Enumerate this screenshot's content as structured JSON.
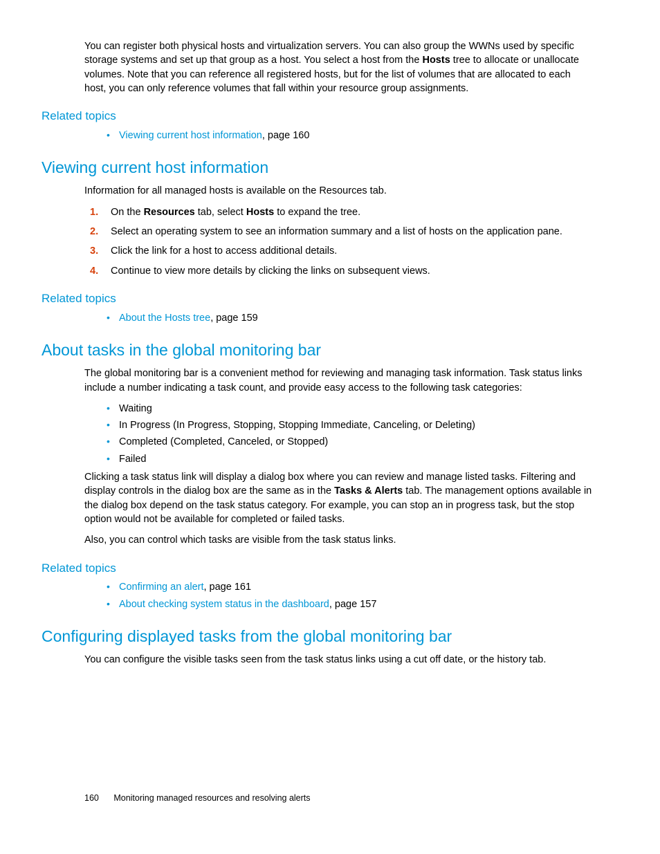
{
  "intro": {
    "p1_a": "You can register both physical hosts and virtualization servers. You can also group the WWNs used by specific storage systems and set up that group as a host. You select a host from the ",
    "p1_b": "Hosts",
    "p1_c": " tree to allocate or unallocate volumes. Note that you can reference all registered hosts, but for the list of volumes that are allocated to each host, you can only reference volumes that fall within your resource group assignments."
  },
  "related1": {
    "heading": "Related topics",
    "link": "Viewing current host information",
    "suffix": ", page 160"
  },
  "sec1": {
    "heading": "Viewing current host information",
    "intro": "Information for all managed hosts is available on the Resources tab.",
    "step1_a": "On the ",
    "step1_b": "Resources",
    "step1_c": " tab, select ",
    "step1_d": "Hosts",
    "step1_e": " to expand the tree.",
    "step2": "Select an operating system to see an information summary and a list of hosts on the application pane.",
    "step3": "Click the link for a host to access additional details.",
    "step4": "Continue to view more details by clicking the links on subsequent views."
  },
  "related2": {
    "heading": "Related topics",
    "link": "About the Hosts tree",
    "suffix": ", page 159"
  },
  "sec2": {
    "heading": "About tasks in the global monitoring bar",
    "intro": "The global monitoring bar is a convenient method for reviewing and managing task information. Task status links include a number indicating a task count, and provide easy access to the following task categories:",
    "b1": "Waiting",
    "b2": "In Progress (In Progress, Stopping, Stopping Immediate, Canceling, or Deleting)",
    "b3": "Completed (Completed, Canceled, or Stopped)",
    "b4": "Failed",
    "p2_a": "Clicking a task status link will display a dialog box where you can review and manage listed tasks. Filtering and display controls in the dialog box are the same as in the ",
    "p2_b": "Tasks & Alerts",
    "p2_c": " tab. The management options available in the dialog box depend on the task status category. For example, you can stop an in progress task, but the stop option would not be available for completed or failed tasks.",
    "p3": "Also, you can control which tasks are visible from the task status links."
  },
  "related3": {
    "heading": "Related topics",
    "link1": "Confirming an alert",
    "suffix1": ", page 161",
    "link2": "About checking system status in the dashboard",
    "suffix2": ", page 157"
  },
  "sec3": {
    "heading": "Configuring displayed tasks from the global monitoring bar",
    "intro": "You can configure the visible tasks seen from the task status links using a cut off date, or the history tab."
  },
  "footer": {
    "page": "160",
    "text": "Monitoring managed resources and resolving alerts"
  }
}
